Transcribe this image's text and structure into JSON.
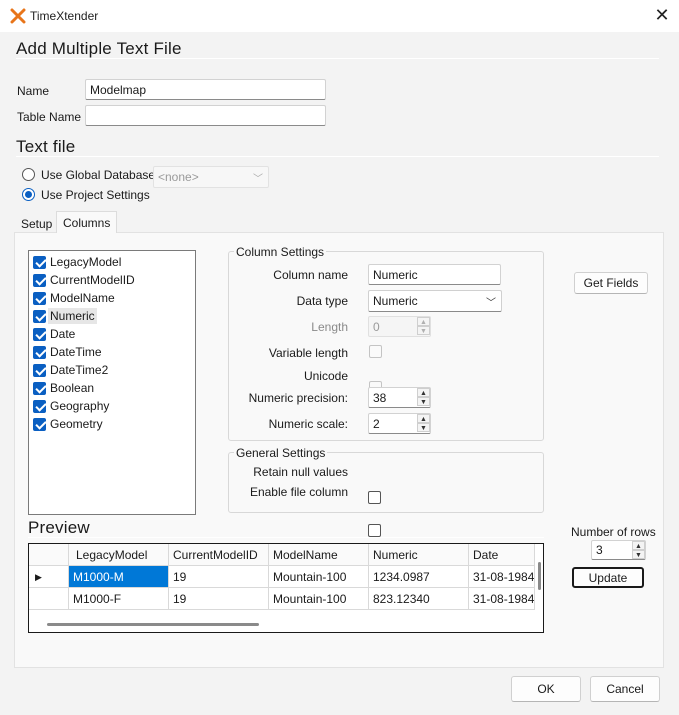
{
  "window": {
    "title": "TimeXtender",
    "close_glyph": "✕",
    "accent": "#e8751a"
  },
  "header": {
    "title": "Add Multiple Text File"
  },
  "fields": {
    "name_label": "Name",
    "name_value": "Modelmap",
    "table_name_label": "Table Name",
    "table_name_value": ""
  },
  "text_file": {
    "title": "Text file",
    "global_db_label": "Use Global Database",
    "global_db_value": "<none>",
    "project_settings_label": "Use Project Settings",
    "selected": "project"
  },
  "tabs": [
    {
      "label": "Setup",
      "active": false
    },
    {
      "label": "Columns",
      "active": true
    }
  ],
  "columns_list": [
    {
      "label": "LegacyModel",
      "checked": true
    },
    {
      "label": "CurrentModelID",
      "checked": true
    },
    {
      "label": "ModelName",
      "checked": true
    },
    {
      "label": "Numeric",
      "checked": true,
      "selected": true
    },
    {
      "label": "Date",
      "checked": true
    },
    {
      "label": "DateTime",
      "checked": true
    },
    {
      "label": "DateTime2",
      "checked": true
    },
    {
      "label": "Boolean",
      "checked": true
    },
    {
      "label": "Geography",
      "checked": true
    },
    {
      "label": "Geometry",
      "checked": true
    }
  ],
  "column_settings": {
    "title": "Column Settings",
    "column_name_label": "Column name",
    "column_name_value": "Numeric",
    "data_type_label": "Data type",
    "data_type_value": "Numeric",
    "length_label": "Length",
    "length_value": "0",
    "variable_length_label": "Variable length",
    "unicode_label": "Unicode",
    "numeric_precision_label": "Numeric precision:",
    "numeric_precision_value": "38",
    "numeric_scale_label": "Numeric scale:",
    "numeric_scale_value": "2"
  },
  "general_settings": {
    "title": "General Settings",
    "retain_null_label": "Retain null values",
    "enable_file_column_label": "Enable file column"
  },
  "get_fields_label": "Get Fields",
  "preview": {
    "title": "Preview",
    "headers": [
      "",
      "LegacyModel",
      "CurrentModelID",
      "ModelName",
      "Numeric",
      "Date"
    ],
    "rows": [
      [
        "▶",
        "M1000-M",
        "19",
        "Mountain-100",
        "1234.0987",
        "31-08-1984"
      ],
      [
        "",
        "M1000-F",
        "19",
        "Mountain-100",
        "823.12340",
        "31-08-1984"
      ]
    ]
  },
  "rows_control": {
    "label": "Number of rows",
    "value": "3",
    "update_label": "Update"
  },
  "footer": {
    "ok_label": "OK",
    "cancel_label": "Cancel"
  }
}
